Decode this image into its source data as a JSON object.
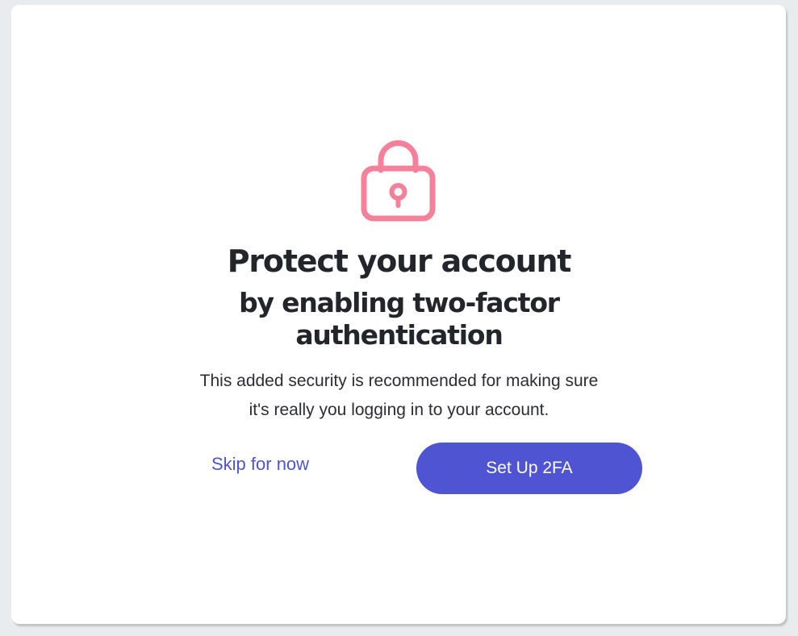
{
  "card": {
    "icon": "lock-icon",
    "title": "Protect your account",
    "subtitle_line1": "by enabling two-factor",
    "subtitle_line2": "authentication",
    "description_line1": "This added security is recommended for making sure",
    "description_line2": "it's really you logging in to your account."
  },
  "actions": {
    "skip_label": "Skip for now",
    "setup_label": "Set Up 2FA"
  },
  "colors": {
    "background": "#e9ecef",
    "card": "#ffffff",
    "icon": "#f5809a",
    "heading": "#24252b",
    "accent": "#4f55d2"
  }
}
